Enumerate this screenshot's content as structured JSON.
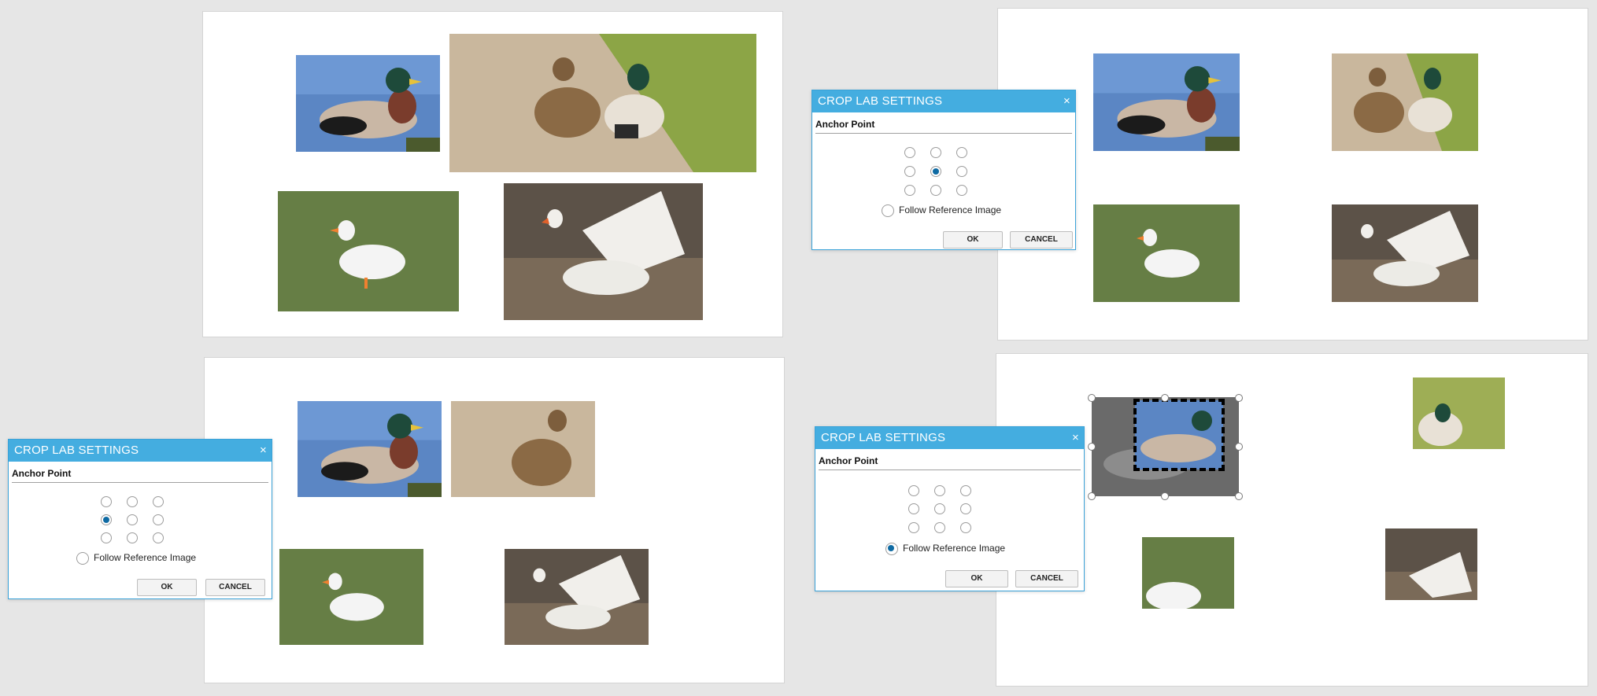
{
  "dialogs": [
    {
      "title": "CROP LAB SETTINGS",
      "close_glyph": "×",
      "section_label": "Anchor Point",
      "anchor_selected": "middle-center",
      "follow_reference_label": "Follow Reference Image",
      "follow_reference_checked": false,
      "ok_label": "OK",
      "cancel_label": "CANCEL"
    },
    {
      "title": "CROP LAB SETTINGS",
      "close_glyph": "×",
      "section_label": "Anchor Point",
      "anchor_selected": "middle-left",
      "follow_reference_label": "Follow Reference Image",
      "follow_reference_checked": false,
      "ok_label": "OK",
      "cancel_label": "CANCEL"
    },
    {
      "title": "CROP LAB SETTINGS",
      "close_glyph": "×",
      "section_label": "Anchor Point",
      "anchor_selected": "none",
      "follow_reference_label": "Follow Reference Image",
      "follow_reference_checked": true,
      "ok_label": "OK",
      "cancel_label": "CANCEL"
    }
  ],
  "photos": {
    "mallard-water": "mallard drake on blue water",
    "duck-pair": "female and male mallard on path",
    "white-duck": "white duck on grass",
    "swan": "white swan spreading wings in water"
  },
  "colors": {
    "title_bar": "#44ade0",
    "dialog_border": "#3aa2d8",
    "radio_selected": "#0e6aa3",
    "background": "#e6e6e6"
  }
}
